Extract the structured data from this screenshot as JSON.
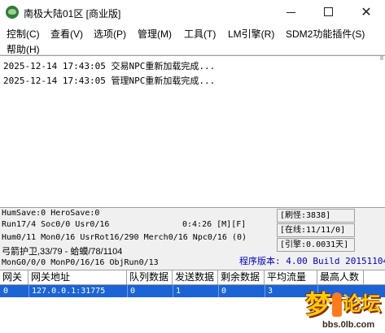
{
  "window": {
    "title": "南极大陆01区 [商业版]",
    "min_glyph": "",
    "max_glyph": "",
    "close_glyph": "✕"
  },
  "menu": {
    "row1": [
      "控制(C)",
      "查看(V)",
      "选项(P)",
      "管理(M)",
      "工具(T)",
      "LM引擎(R)",
      "SDM2功能插件(S)"
    ],
    "row2": [
      "帮助(H)"
    ]
  },
  "log": {
    "lines": [
      "2025-12-14 17:43:05 交易NPC重新加载完成...",
      "2025-12-14 17:43:05 管理NPC重新加载完成..."
    ]
  },
  "status": {
    "line1": "HumSave:0 HeroSave:0",
    "line2": "Run17/4 Soc0/0 Usr0/16",
    "timer": "0:4:26 [M][F]",
    "line3": "Hum0/11 Mon0/16 UsrRot16/290 Merch0/16 Npc0/16 (0)",
    "line4": "弓箭护卫,33/79 - 蛤蟆/78/1104",
    "line5": "MonG0/0/0 MonP0/16/16 ObjRun0/13",
    "refresh": "[刷怪:3838]",
    "online": "[在线:11/11/0]",
    "engine": "[引擎:0.0031天]",
    "version": "程序版本: 4.00 Build 20151104"
  },
  "table": {
    "headers": [
      "网关",
      "网关地址",
      "队列数据",
      "发送数据",
      "剩余数据",
      "平均流量",
      "最高人数"
    ],
    "rows": [
      [
        "0",
        "127.0.0.1:31775",
        "0",
        "1",
        "0",
        "3",
        ""
      ]
    ]
  },
  "watermark": {
    "glyph1": "梦",
    "glyph2": "论坛",
    "url": "bbs.0lb.com"
  },
  "colors": {
    "selection": "#1a64d6",
    "version_text": "#0000cc",
    "panel_bg": "#f0f0f0"
  }
}
